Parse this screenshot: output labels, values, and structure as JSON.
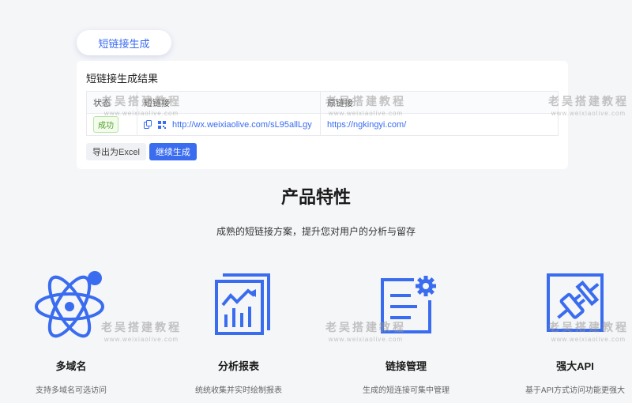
{
  "tab": {
    "label": "短链接生成"
  },
  "result": {
    "title": "短链接生成结果",
    "columns": [
      "状态",
      "短链接",
      "原链接"
    ],
    "rows": [
      {
        "status": "成功",
        "short_url": "http://wx.weixiaolive.com/sL95allLgy",
        "original_url": "https://ngkingyi.com/"
      }
    ],
    "export_button": "导出为Excel",
    "continue_button": "继续生成"
  },
  "features": {
    "title": "产品特性",
    "subtitle": "成熟的短链接方案，提升您对用户的分析与留存",
    "items": [
      {
        "name": "多域名",
        "desc": "支持多域名可选访问",
        "icon": "atom-icon"
      },
      {
        "name": "分析报表",
        "desc": "统统收集并实时绘制报表",
        "icon": "chart-report-icon"
      },
      {
        "name": "链接管理",
        "desc": "生成的短连接可集中管理",
        "icon": "document-gear-icon"
      },
      {
        "name": "强大API",
        "desc": "基于API方式访问功能更强大",
        "icon": "plug-icon"
      }
    ]
  },
  "watermark": {
    "main": "老吴搭建教程",
    "sub": "www.weixiaolive.com"
  },
  "colors": {
    "accent": "#3a6cf0",
    "success": "#52a12a",
    "background": "#f5f6f8"
  }
}
